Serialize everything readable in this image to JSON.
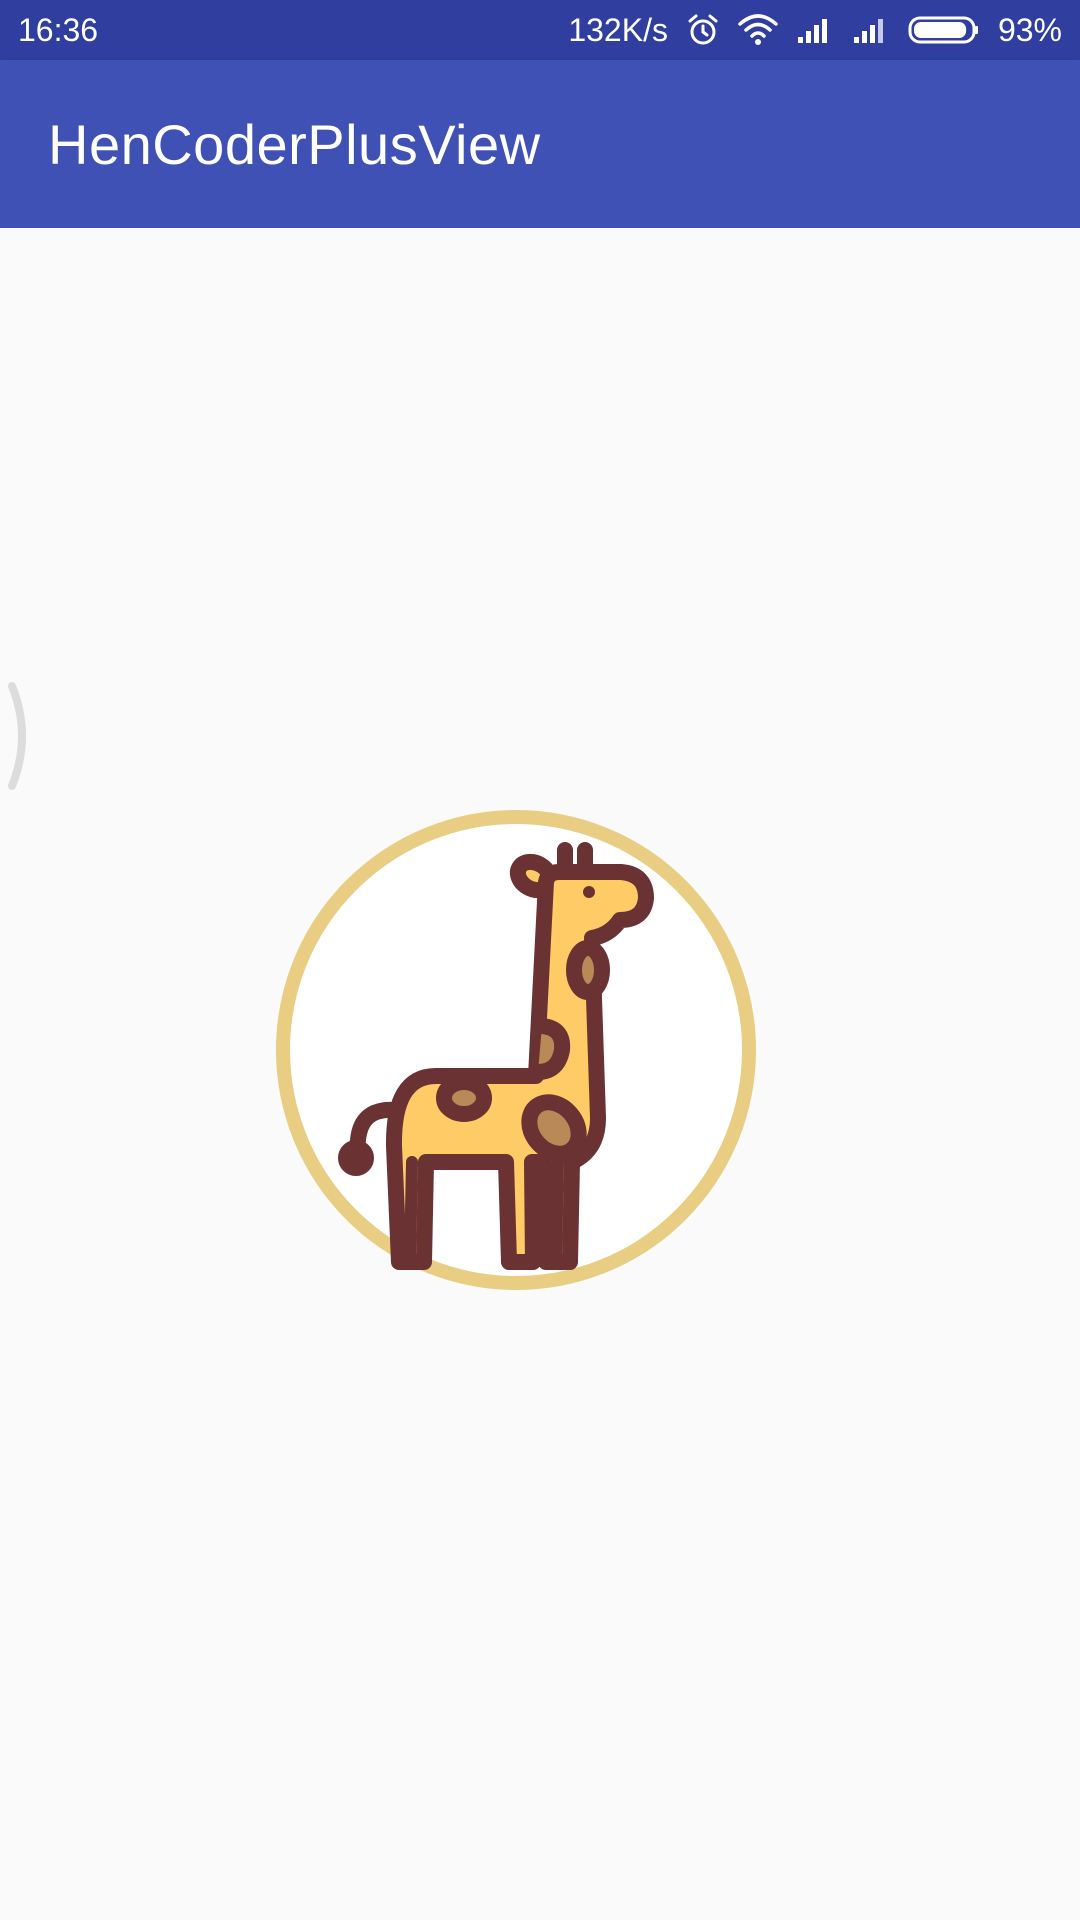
{
  "status_bar": {
    "time": "16:36",
    "network_speed": "132K/s",
    "battery_percent": "93%",
    "battery_level": 0.93,
    "icons": [
      "alarm-icon",
      "wifi-icon",
      "cell-signal-icon",
      "cell-signal-icon",
      "battery-icon"
    ]
  },
  "app_bar": {
    "title": "HenCoderPlusView"
  },
  "avatar": {
    "icon": "giraffe-icon",
    "ring_color": "#e8cd82",
    "fill_color": "#ffffff"
  },
  "colors": {
    "status_bar": "#303f9f",
    "app_bar": "#3f51b5",
    "background": "#fafafa"
  }
}
